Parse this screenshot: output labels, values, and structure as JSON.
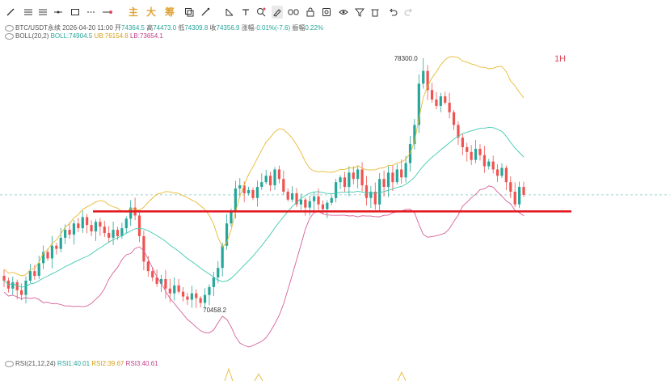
{
  "toolbar": {
    "cn_labels": [
      "主",
      "大",
      "筹"
    ]
  },
  "ticker": {
    "symbol": "BTC/USDT永续",
    "datetime": "2026-04-20 11:00",
    "open_label": "开",
    "open": "74364.5",
    "high_label": "高",
    "high": "74473.0",
    "low_label": "低",
    "low": "74309.8",
    "close_label": "收",
    "close": "74356.9",
    "change_label": "涨幅",
    "change": "-0.01%(-7.6)",
    "amp_label": "振幅",
    "amp": "0.22%"
  },
  "boll": {
    "label": "BOLL(20,2)",
    "mid": "BOLL:74904.5",
    "ub": "UB:76154.8",
    "lb": "LB:73654.1"
  },
  "rsi": {
    "label": "RSI(21,12,24)",
    "rsi1": "RSI1:40.01",
    "rsi2": "RSI2:39.67",
    "rsi3": "RSI3:40.61"
  },
  "colors": {
    "up": "#26a69a",
    "down": "#ef5350",
    "boll_ub_lb_upper": "#e8b931",
    "boll_mid": "#3fc9b0",
    "boll_lower": "#d6609a",
    "support_line": "#e31b23",
    "timeframe": "#e0495b"
  },
  "chart_data": {
    "type": "candlestick",
    "timeframe": "1H",
    "annotations": [
      {
        "text": "78300.0",
        "kind": "high"
      },
      {
        "text": "70458.2",
        "kind": "low"
      }
    ],
    "support_level": 73480,
    "candles_close": [
      71300,
      71050,
      71250,
      71000,
      70850,
      71300,
      71600,
      71450,
      71850,
      72200,
      72000,
      72400,
      72300,
      72650,
      72900,
      72750,
      73100,
      72950,
      73300,
      73050,
      72850,
      73150,
      73000,
      72800,
      72650,
      72900,
      72700,
      72950,
      73250,
      73600,
      73350,
      72700,
      71900,
      71600,
      71400,
      71200,
      71350,
      71050,
      70900,
      71150,
      70950,
      70800,
      70700,
      70900,
      70750,
      70600,
      70850,
      71100,
      71400,
      71700,
      72400,
      73100,
      73500,
      74200,
      74300,
      74050,
      74150,
      73900,
      74250,
      74400,
      74600,
      74300,
      74800,
      74500,
      74100,
      73850,
      74050,
      73700,
      73850,
      73600,
      73800,
      73950,
      73700,
      73550,
      73750,
      73900,
      74400,
      74550,
      74250,
      74700,
      74500,
      74800,
      74300,
      73900,
      74100,
      73700,
      74500,
      74250,
      74700,
      74400,
      74800,
      74550,
      75000,
      75600,
      76200,
      77500,
      77900,
      77300,
      77000,
      76800,
      77100,
      76900,
      76600,
      76200,
      75800,
      75500,
      75350,
      75100,
      75450,
      75250,
      74900,
      75050,
      74800,
      74600,
      74850,
      74400,
      74100,
      73700,
      74250,
      74000
    ],
    "rsi_series": [
      "RSI1",
      "RSI2",
      "RSI3"
    ]
  }
}
